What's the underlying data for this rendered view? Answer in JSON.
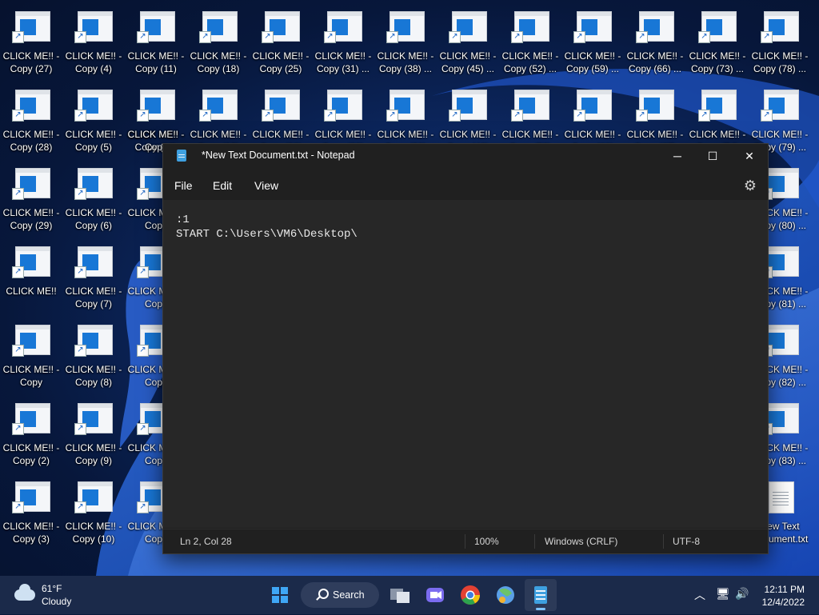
{
  "desktop": {
    "icons": [
      {
        "label": "CLICK ME!! - Copy (27)",
        "icon": "shortcut-icon"
      },
      {
        "label": "CLICK ME!! - Copy (4)",
        "icon": "shortcut-icon"
      },
      {
        "label": "CLICK ME!! - Copy (11)",
        "icon": "shortcut-icon"
      },
      {
        "label": "CLICK ME!! - Copy (18)",
        "icon": "shortcut-icon"
      },
      {
        "label": "CLICK ME!! - Copy (25)",
        "icon": "shortcut-icon"
      },
      {
        "label": "CLICK ME!! - Copy (31) ...",
        "icon": "shortcut-icon"
      },
      {
        "label": "CLICK ME!! - Copy (38) ...",
        "icon": "shortcut-icon"
      },
      {
        "label": "CLICK ME!! - Copy (45) ...",
        "icon": "shortcut-icon"
      },
      {
        "label": "CLICK ME!! - Copy (52) ...",
        "icon": "shortcut-icon"
      },
      {
        "label": "CLICK ME!! - Copy (59) ...",
        "icon": "shortcut-icon"
      },
      {
        "label": "CLICK ME!! - Copy (66) ...",
        "icon": "shortcut-icon"
      },
      {
        "label": "CLICK ME!! - Copy (73) ...",
        "icon": "shortcut-icon"
      },
      {
        "label": "CLICK ME!! - Copy (78) ...",
        "icon": "shortcut-icon"
      },
      {
        "label": "CLICK ME!! - Copy (28)",
        "icon": "shortcut-icon"
      },
      {
        "label": "CLICK ME!! - Copy (5)",
        "icon": "shortcut-icon"
      },
      {
        "label": "CLICK ME!! - Copy (12)",
        "icon": "shortcut-icon"
      },
      {
        "label": "CLICK ME!! - Copy (19)",
        "icon": "shortcut-icon"
      },
      {
        "label": "CLICK ME!! - Copy (26)",
        "icon": "shortcut-icon"
      },
      {
        "label": "CLICK ME!! - Copy (32)",
        "icon": "shortcut-icon"
      },
      {
        "label": "CLICK ME!! - Copy (39)",
        "icon": "shortcut-icon"
      },
      {
        "label": "CLICK ME!! - Copy (46)",
        "icon": "shortcut-icon"
      },
      {
        "label": "CLICK ME!! - Copy (53)",
        "icon": "shortcut-icon"
      },
      {
        "label": "CLICK ME!! - Copy (60)",
        "icon": "shortcut-icon"
      },
      {
        "label": "CLICK ME!! - Copy (67)",
        "icon": "shortcut-icon"
      },
      {
        "label": "CLICK ME!! - Copy (74)",
        "icon": "shortcut-icon"
      },
      {
        "label": "CLICK ME!! - Copy (79) ...",
        "icon": "shortcut-icon"
      },
      {
        "label": "CLICK ME!! - Copy (29)",
        "icon": "shortcut-icon"
      },
      {
        "label": "CLICK ME!! - Copy (6)",
        "icon": "shortcut-icon"
      },
      {
        "label": "CLICK ME!! - Copy (80) ...",
        "icon": "shortcut-icon"
      },
      {
        "label": "CLICK ME!!",
        "icon": "shortcut-icon"
      },
      {
        "label": "CLICK ME!! - Copy (7)",
        "icon": "shortcut-icon"
      },
      {
        "label": "CLICK ME!! - Copy (81) ...",
        "icon": "shortcut-icon"
      },
      {
        "label": "CLICK ME!! - Copy",
        "icon": "shortcut-icon"
      },
      {
        "label": "CLICK ME!! - Copy (8)",
        "icon": "shortcut-icon"
      },
      {
        "label": "CLICK ME!! - Copy (82) ...",
        "icon": "shortcut-icon"
      },
      {
        "label": "CLICK ME!! - Copy (2)",
        "icon": "shortcut-icon"
      },
      {
        "label": "CLICK ME!! - Copy (9)",
        "icon": "shortcut-icon"
      },
      {
        "label": "CLICK ME!! - Copy (83) ...",
        "icon": "shortcut-icon"
      },
      {
        "label": "CLICK ME!! - Copy (3)",
        "icon": "shortcut-icon"
      },
      {
        "label": "CLICK ME!! - Copy (10)",
        "icon": "shortcut-icon"
      },
      {
        "label": "New Text Document.txt",
        "icon": "text-file-icon"
      },
      {
        "label": "CLICK ME!! - Copy",
        "icon": "shortcut-icon"
      },
      {
        "label": "CLICK ME!! - Copy",
        "icon": "shortcut-icon"
      },
      {
        "label": "CLICK ME!! - Copy",
        "icon": "shortcut-icon"
      },
      {
        "label": "CLICK ME!! - Copy",
        "icon": "shortcut-icon"
      },
      {
        "label": "CLICK ME!! - Copy",
        "icon": "shortcut-icon"
      },
      {
        "label": "CLICK ME!! - Copy",
        "icon": "shortcut-icon"
      }
    ]
  },
  "notepad": {
    "title": "*New Text Document.txt - Notepad",
    "minimize": "─",
    "maximize": "☐",
    "close": "✕",
    "menu": {
      "file": "File",
      "edit": "Edit",
      "view": "View"
    },
    "settings_icon": "⚙",
    "content_lines": [
      ":1",
      "START C:\\Users\\VM6\\Desktop\\"
    ],
    "status": {
      "position": "Ln 2, Col 28",
      "zoom": "100%",
      "line_ending": "Windows (CRLF)",
      "encoding": "UTF-8"
    }
  },
  "taskbar": {
    "weather": {
      "temp": "61°F",
      "condition": "Cloudy"
    },
    "search_label": "Search",
    "tray": {
      "chevron": "︿",
      "network": "🖥",
      "volume": "🔊"
    },
    "clock": {
      "time": "12:11 PM",
      "date": "12/4/2022"
    }
  },
  "colors": {
    "accent": "#1877d6",
    "taskbar": "#1b2a4a",
    "notepad_bg": "#272727"
  }
}
